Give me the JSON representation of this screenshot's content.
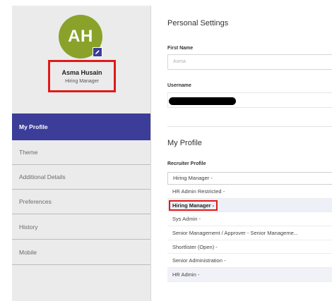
{
  "profile": {
    "initials": "AH",
    "name": "Asma Husain",
    "role": "Hiring Manager",
    "avatar_color": "#8aa22a",
    "edit_icon": "pencil-icon"
  },
  "sidebar": {
    "items": [
      {
        "label": "My Profile",
        "active": true
      },
      {
        "label": "Theme"
      },
      {
        "label": "Additional Details"
      },
      {
        "label": "Preferences"
      },
      {
        "label": "History"
      },
      {
        "label": "Mobile"
      }
    ],
    "active_color": "#3b3d99"
  },
  "personal_settings": {
    "title": "Personal Settings",
    "first_name_label": "First Name",
    "first_name_value": "Asma",
    "username_label": "Username"
  },
  "my_profile": {
    "title": "My Profile",
    "recruiter_profile_label": "Recruiter Profile",
    "selected_value": "Hiring Manager -",
    "options": [
      "HR Admin Restricted -",
      "Hiring Manager -",
      "Sys Admin -",
      "Senior Management / Approver - Senior Manageme...",
      "Shortlister (Open) -",
      "Senior Administration -",
      "HR Admin -"
    ]
  },
  "highlight_color": "#e01a1a"
}
